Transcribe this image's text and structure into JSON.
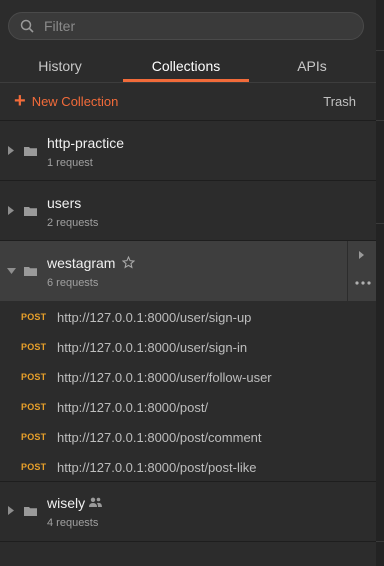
{
  "search": {
    "placeholder": "Filter",
    "icon": "search-icon"
  },
  "tabs": [
    {
      "label": "History",
      "active": false
    },
    {
      "label": "Collections",
      "active": true
    },
    {
      "label": "APIs",
      "active": false
    }
  ],
  "toolbar": {
    "new_collection_label": "New Collection",
    "trash_label": "Trash"
  },
  "collections": [
    {
      "name": "http-practice",
      "count": "1 request",
      "expanded": false
    },
    {
      "name": "users",
      "count": "2 requests",
      "expanded": false
    },
    {
      "name": "westagram",
      "count": "6 requests",
      "expanded": true,
      "starred_icon": "star-outline-icon",
      "requests": [
        {
          "method": "POST",
          "url": "http://127.0.0.1:8000/user/sign-up"
        },
        {
          "method": "POST",
          "url": "http://127.0.0.1:8000/user/sign-in"
        },
        {
          "method": "POST",
          "url": "http://127.0.0.1:8000/user/follow-user"
        },
        {
          "method": "POST",
          "url": "http://127.0.0.1:8000/post/"
        },
        {
          "method": "POST",
          "url": "http://127.0.0.1:8000/post/comment"
        },
        {
          "method": "POST",
          "url": "http://127.0.0.1:8000/post/post-like"
        }
      ]
    },
    {
      "name": "wisely",
      "count": "4 requests",
      "expanded": false,
      "shared_icon": "team-icon"
    }
  ],
  "colors": {
    "accent": "#f26b3a",
    "post_method": "#e8a02a",
    "background": "#2c2c2c",
    "selected": "#3e3e3e"
  }
}
